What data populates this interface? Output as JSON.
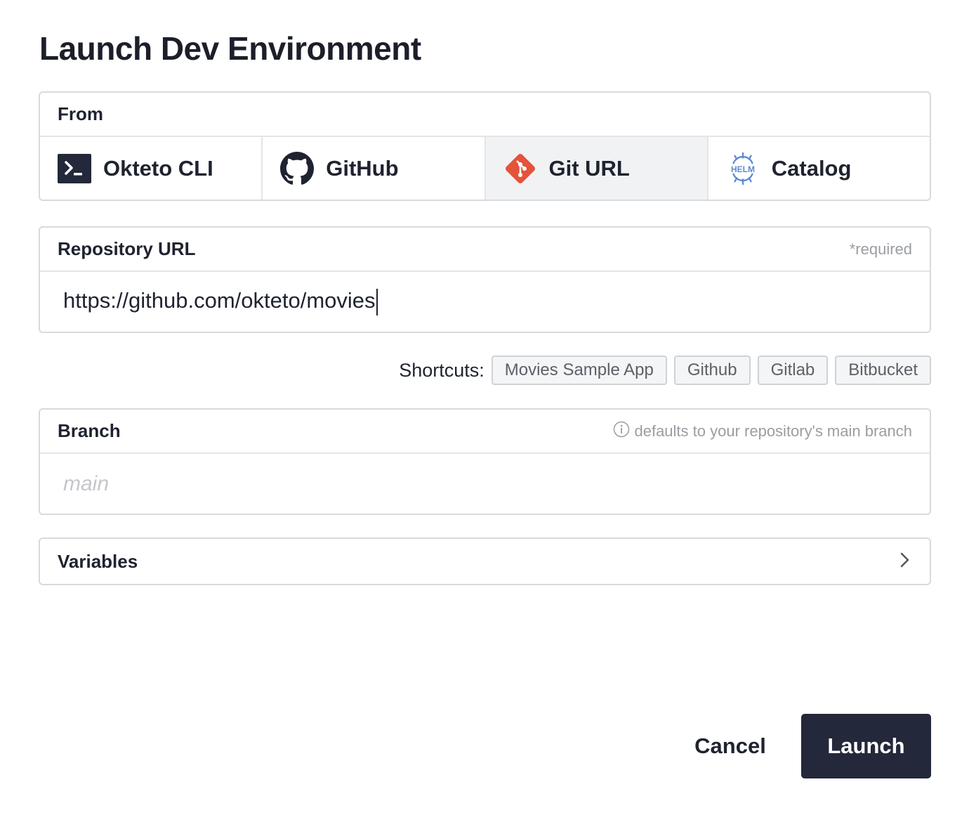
{
  "dialog": {
    "title": "Launch Dev Environment"
  },
  "from": {
    "label": "From",
    "selected": "Git URL",
    "tabs": [
      {
        "label": "Okteto CLI",
        "icon": "terminal-icon"
      },
      {
        "label": "GitHub",
        "icon": "github-icon"
      },
      {
        "label": "Git URL",
        "icon": "git-icon"
      },
      {
        "label": "Catalog",
        "icon": "helm-icon"
      }
    ],
    "helm_icon_text": "HELM"
  },
  "repository": {
    "label": "Repository URL",
    "required_hint": "*required",
    "value": "https://github.com/okteto/movies"
  },
  "shortcuts": {
    "label": "Shortcuts:",
    "items": [
      "Movies Sample App",
      "Github",
      "Gitlab",
      "Bitbucket"
    ]
  },
  "branch": {
    "label": "Branch",
    "hint": "defaults to your repository's main branch",
    "placeholder": "main",
    "value": ""
  },
  "variables": {
    "label": "Variables"
  },
  "footer": {
    "cancel_label": "Cancel",
    "launch_label": "Launch"
  },
  "colors": {
    "primary": "#23283a",
    "git_orange": "#e4533a",
    "helm_blue": "#5b8bd6",
    "border": "#d8dadd",
    "active_tab_bg": "#f1f2f4"
  }
}
